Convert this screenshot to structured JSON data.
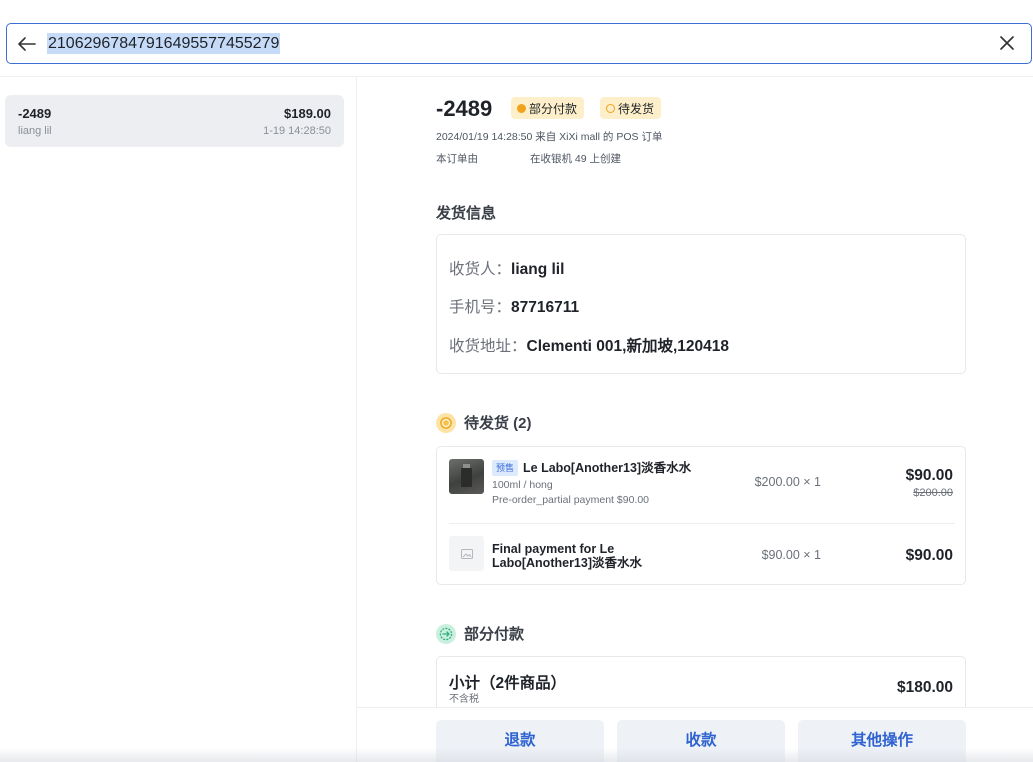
{
  "search": {
    "query": "21062967847916495577455279"
  },
  "order_list": [
    {
      "id": "-2489",
      "amount": "$189.00",
      "customer": "liang lil",
      "time": "1-19 14:28:50"
    }
  ],
  "order": {
    "title": "-2489",
    "badge_payment": "部分付款",
    "badge_fulfillment": "待发货",
    "meta_line_1": "2024/01/19 14:28:50 来自 XiXi mall 的 POS 订单",
    "meta_line_2_left": "本订单由",
    "meta_line_2_right": "在收银机  49  上创建"
  },
  "shipping": {
    "section_title": "发货信息",
    "recipient_label": "收货人：",
    "recipient_value": "liang lil",
    "phone_label": "手机号：",
    "phone_value": "87716711",
    "address_label": "收货地址：",
    "address_value": "Clementi 001,新加坡,120418"
  },
  "pending_group": {
    "title": "待发货 (2)",
    "icon": "clock-icon",
    "items": [
      {
        "tag": "预售",
        "name": "Le Labo[Another13]淡香水水",
        "variant": "100ml / hong",
        "note": "Pre-order_partial payment $90.00",
        "qty": "$200.00 × 1",
        "price": "$90.00",
        "original_price": "$200.00"
      },
      {
        "name": "Final payment for Le Labo[Another13]淡香水水",
        "qty": "$90.00 × 1",
        "price": "$90.00"
      }
    ]
  },
  "payment_group": {
    "title": "部分付款",
    "icon": "arrow-circle-icon"
  },
  "summary": {
    "label": "小计（2件商品）",
    "sub": "不含税",
    "amount": "$180.00"
  },
  "actions": {
    "refund": "退款",
    "collect": "收款",
    "more": "其他操作"
  },
  "colors": {
    "accent": "#3b6fd6",
    "badge_bg": "#fdefc9",
    "badge_dot": "#f0a31c",
    "button_text": "#2f63d1"
  }
}
